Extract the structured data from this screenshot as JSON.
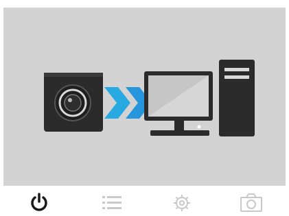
{
  "illustration": {
    "caption": "",
    "background_color": "#d3d3d3",
    "items": [
      "camera-device-icon",
      "transfer-arrows-icon",
      "monitor-icon",
      "desktop-tower-icon"
    ],
    "arrow_colors": [
      "#29a9e1",
      "#1f7fd0"
    ]
  },
  "tabbar": {
    "tabs": [
      {
        "name": "power",
        "icon": "power-icon",
        "active": true
      },
      {
        "name": "list",
        "icon": "list-icon",
        "active": false
      },
      {
        "name": "settings",
        "icon": "settings-gear-icon",
        "active": false
      },
      {
        "name": "camera",
        "icon": "camera-icon",
        "active": false
      }
    ],
    "active_color": "#1a1a1a",
    "inactive_color": "#c8c8c8"
  }
}
